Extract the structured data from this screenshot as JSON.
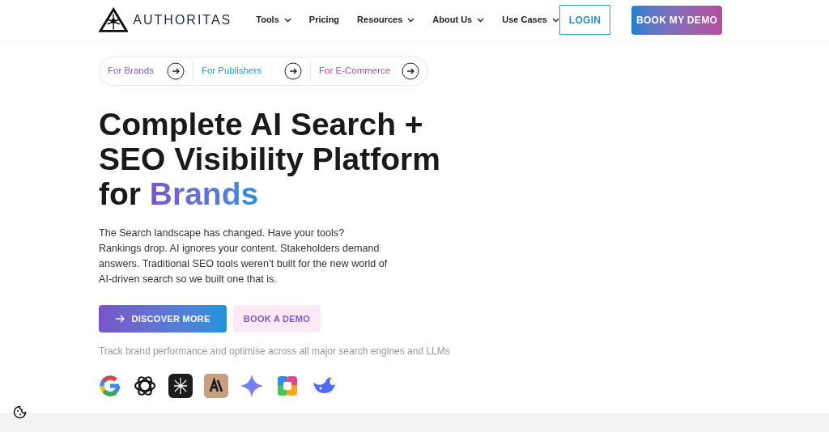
{
  "logo": {
    "text": "AUTHORITAS"
  },
  "nav": [
    {
      "label": "Tools",
      "has_menu": true
    },
    {
      "label": "Pricing",
      "has_menu": false
    },
    {
      "label": "Resources",
      "has_menu": true
    },
    {
      "label": "About Us",
      "has_menu": true
    },
    {
      "label": "Use Cases",
      "has_menu": true
    }
  ],
  "login_button": "LOGIN",
  "demo_button": "BOOK MY DEMO",
  "audiences": [
    {
      "label": "For Brands",
      "color": "#7c5cc4"
    },
    {
      "label": "For Publishers",
      "color": "#1f9cc9"
    },
    {
      "label": "For E-Commerce",
      "color": "#b84a9c"
    }
  ],
  "headline": {
    "text": "Complete AI Search + SEO Visibility Platform for",
    "highlight": "Brands"
  },
  "intro": [
    "The Search landscape has changed. Have your tools?",
    "Rankings drop. AI ignores your content. Stakeholders demand answers. Traditional SEO tools weren’t built for the new world of AI-driven search so we built one that is."
  ],
  "primary_button": "DISCOVER MORE",
  "secondary_button": "BOOK A DEMO",
  "engines_caption": "Track brand performance and optimise across all major search engines and LLMs"
}
